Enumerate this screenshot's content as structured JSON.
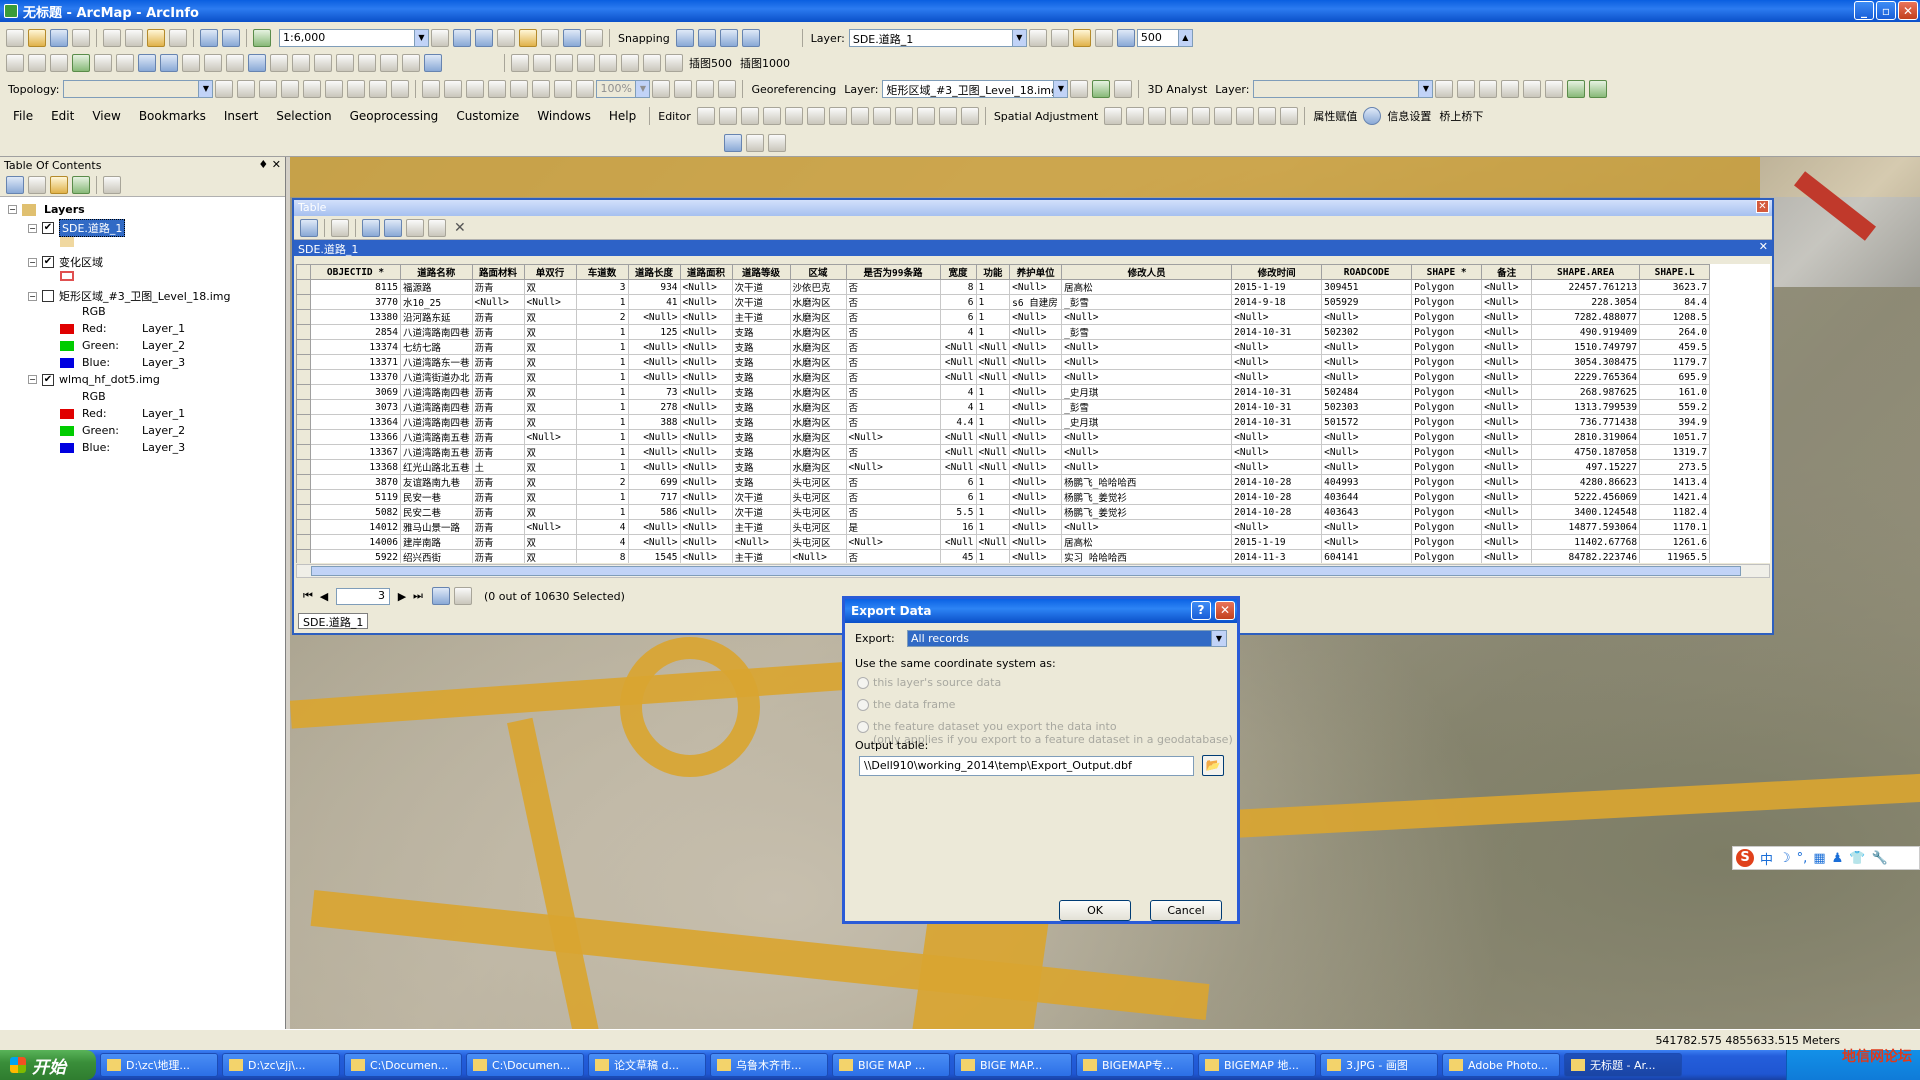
{
  "window": {
    "title": "无标题 - ArcMap - ArcInfo"
  },
  "toolbar": {
    "scale": "1:6,000",
    "snapping": "Snapping",
    "layer_label": "Layer:",
    "layer_value": "SDE.道路_1",
    "number_value": "500",
    "topology_label": "Topology:",
    "georef_label": "Georeferencing",
    "georef_layer_label": "Layer:",
    "georef_layer_value": "矩形区域_#3_卫图_Level_18.img",
    "zoom_percent": "100%",
    "analyst_3d": "3D Analyst",
    "analyst_layer_label": "Layer:",
    "btn_insert500": "插图500",
    "btn_insert1000": "插图1000",
    "editor": "Editor",
    "spatial_adjustment": "Spatial Adjustment",
    "attr_assign": "属性赋值",
    "info_settings": "信息设置",
    "bridge": "桥上桥下"
  },
  "menu": [
    "File",
    "Edit",
    "View",
    "Bookmarks",
    "Insert",
    "Selection",
    "Geoprocessing",
    "Customize",
    "Windows",
    "Help"
  ],
  "toc": {
    "title": "Table Of Contents",
    "root": "Layers",
    "layers": [
      {
        "name": "SDE.道路_1",
        "checked": true,
        "selected": true
      },
      {
        "name": "变化区域",
        "checked": true
      },
      {
        "name": "矩形区域_#3_卫图_Level_18.img",
        "checked": false
      },
      {
        "name": "wlmq_hf_dot5.img",
        "checked": true
      }
    ],
    "rgb": "RGB",
    "bands": [
      {
        "label": "Red:",
        "value": "Layer_1",
        "color": "#e00000"
      },
      {
        "label": "Green:",
        "value": "Layer_2",
        "color": "#00cc00"
      },
      {
        "label": "Blue:",
        "value": "Layer_3",
        "color": "#0000e0"
      }
    ]
  },
  "table": {
    "window_title": "Table",
    "tab_title": "SDE.道路_1",
    "columns": [
      "OBJECTID *",
      "道路名称",
      "路面材料",
      "单双行",
      "车道数",
      "道路长度",
      "道路面积",
      "道路等级",
      "区域",
      "是否为99条路",
      "宽度",
      "功能",
      "养护单位",
      "修改人员",
      "修改时间",
      "ROADCODE",
      "SHAPE *",
      "备注",
      "SHAPE.AREA",
      "SHAPE.L"
    ],
    "rows": [
      [
        "8115",
        "福源路",
        "沥青",
        "双",
        "3",
        "934",
        "<Null>",
        "次干道",
        "沙依巴克",
        "否",
        "8",
        "1",
        "<Null>",
        "居高松",
        "2015-1-19",
        "309451",
        "Polygon",
        "<Null>",
        "22457.761213",
        "3623.7"
      ],
      [
        "3770",
        "水10_25",
        "<Null>",
        "<Null>",
        "1",
        "41",
        "<Null>",
        "次干道",
        "水磨沟区",
        "否",
        "6",
        "1",
        "s6 自建房",
        "_彭雪",
        "2014-9-18",
        "505929",
        "Polygon",
        "<Null>",
        "228.3054",
        "84.4"
      ],
      [
        "13380",
        "沿河路东延",
        "沥青",
        "双",
        "2",
        "<Null>",
        "<Null>",
        "主干道",
        "水磨沟区",
        "否",
        "6",
        "1",
        "<Null>",
        "<Null>",
        "<Null>",
        "<Null>",
        "Polygon",
        "<Null>",
        "7282.488077",
        "1208.5"
      ],
      [
        "2854",
        "八道湾路南四巷",
        "沥青",
        "双",
        "1",
        "125",
        "<Null>",
        "支路",
        "水磨沟区",
        "否",
        "4",
        "1",
        "<Null>",
        "_彭雪",
        "2014-10-31",
        "502302",
        "Polygon",
        "<Null>",
        "490.919409",
        "264.0"
      ],
      [
        "13374",
        "七纺七路",
        "沥青",
        "双",
        "1",
        "<Null>",
        "<Null>",
        "支路",
        "水磨沟区",
        "否",
        "<Null",
        "<Null",
        "<Null>",
        "<Null>",
        "<Null>",
        "<Null>",
        "Polygon",
        "<Null>",
        "1510.749797",
        "459.5"
      ],
      [
        "13371",
        "八道湾路东一巷",
        "沥青",
        "双",
        "1",
        "<Null>",
        "<Null>",
        "支路",
        "水磨沟区",
        "否",
        "<Null",
        "<Null",
        "<Null>",
        "<Null>",
        "<Null>",
        "<Null>",
        "Polygon",
        "<Null>",
        "3054.308475",
        "1179.7"
      ],
      [
        "13370",
        "八道湾街道办北",
        "沥青",
        "双",
        "1",
        "<Null>",
        "<Null>",
        "支路",
        "水磨沟区",
        "否",
        "<Null",
        "<Null",
        "<Null>",
        "<Null>",
        "<Null>",
        "<Null>",
        "Polygon",
        "<Null>",
        "2229.765364",
        "695.9"
      ],
      [
        "3069",
        "八道湾路南四巷",
        "沥青",
        "双",
        "1",
        "73",
        "<Null>",
        "支路",
        "水磨沟区",
        "否",
        "4",
        "1",
        "<Null>",
        "_史月琪",
        "2014-10-31",
        "502484",
        "Polygon",
        "<Null>",
        "268.987625",
        "161.0"
      ],
      [
        "3073",
        "八道湾路南四巷",
        "沥青",
        "双",
        "1",
        "278",
        "<Null>",
        "支路",
        "水磨沟区",
        "否",
        "4",
        "1",
        "<Null>",
        "_彭雪",
        "2014-10-31",
        "502303",
        "Polygon",
        "<Null>",
        "1313.799539",
        "559.2"
      ],
      [
        "13364",
        "八道湾路南四巷",
        "沥青",
        "双",
        "1",
        "388",
        "<Null>",
        "支路",
        "水磨沟区",
        "否",
        "4.4",
        "1",
        "<Null>",
        "_史月琪",
        "2014-10-31",
        "501572",
        "Polygon",
        "<Null>",
        "736.771438",
        "394.9"
      ],
      [
        "13366",
        "八道湾路南五巷",
        "沥青",
        "<Null>",
        "1",
        "<Null>",
        "<Null>",
        "支路",
        "水磨沟区",
        "<Null>",
        "<Null",
        "<Null",
        "<Null>",
        "<Null>",
        "<Null>",
        "<Null>",
        "Polygon",
        "<Null>",
        "2810.319064",
        "1051.7"
      ],
      [
        "13367",
        "八道湾路南五巷",
        "沥青",
        "双",
        "1",
        "<Null>",
        "<Null>",
        "支路",
        "水磨沟区",
        "否",
        "<Null",
        "<Null",
        "<Null>",
        "<Null>",
        "<Null>",
        "<Null>",
        "Polygon",
        "<Null>",
        "4750.187058",
        "1319.7"
      ],
      [
        "13368",
        "红光山路北五巷",
        "土",
        "双",
        "1",
        "<Null>",
        "<Null>",
        "支路",
        "水磨沟区",
        "<Null>",
        "<Null",
        "<Null",
        "<Null>",
        "<Null>",
        "<Null>",
        "<Null>",
        "Polygon",
        "<Null>",
        "497.15227",
        "273.5"
      ],
      [
        "3870",
        "友谊路南九巷",
        "沥青",
        "双",
        "2",
        "699",
        "<Null>",
        "支路",
        "头屯河区",
        "否",
        "6",
        "1",
        "<Null>",
        "杨鹏飞_哈哈哈西",
        "2014-10-28",
        "404993",
        "Polygon",
        "<Null>",
        "4280.86623",
        "1413.4"
      ],
      [
        "5119",
        "民安一巷",
        "沥青",
        "双",
        "1",
        "717",
        "<Null>",
        "次干道",
        "头屯河区",
        "否",
        "6",
        "1",
        "<Null>",
        "杨鹏飞_姜觉衫",
        "2014-10-28",
        "403644",
        "Polygon",
        "<Null>",
        "5222.456069",
        "1421.4"
      ],
      [
        "5082",
        "民安二巷",
        "沥青",
        "双",
        "1",
        "586",
        "<Null>",
        "次干道",
        "头屯河区",
        "否",
        "5.5",
        "1",
        "<Null>",
        "杨鹏飞_姜觉衫",
        "2014-10-28",
        "403643",
        "Polygon",
        "<Null>",
        "3400.124548",
        "1182.4"
      ],
      [
        "14012",
        "雅马山景一路",
        "沥青",
        "<Null>",
        "4",
        "<Null>",
        "<Null>",
        "主干道",
        "头屯河区",
        "是",
        "16",
        "1",
        "<Null>",
        "<Null>",
        "<Null>",
        "<Null>",
        "Polygon",
        "<Null>",
        "14877.593064",
        "1170.1"
      ],
      [
        "14006",
        "建岸南路",
        "沥青",
        "双",
        "4",
        "<Null>",
        "<Null>",
        "<Null>",
        "头屯河区",
        "<Null>",
        "<Null",
        "<Null",
        "<Null>",
        "居高松",
        "2015-1-19",
        "<Null>",
        "Polygon",
        "<Null>",
        "11402.67768",
        "1261.6"
      ],
      [
        "5922",
        "绍兴西街",
        "沥青",
        "双",
        "8",
        "1545",
        "<Null>",
        "主干道",
        "<Null>",
        "否",
        "45",
        "1",
        "<Null>",
        "实习_哈哈哈西",
        "2014-11-3",
        "604141",
        "Polygon",
        "<Null>",
        "84782.223746",
        "11965.5"
      ]
    ],
    "page": "3",
    "selection_info": "(0 out of 10630 Selected)",
    "bottom_tab": "SDE.道路_1"
  },
  "dialog": {
    "title": "Export Data",
    "export_label": "Export:",
    "export_value": "All records",
    "coord_label": "Use the same coordinate system as:",
    "opt1": "this layer's source data",
    "opt2": "the data frame",
    "opt3": "the feature dataset you export the data into",
    "opt3_note": "(only applies if you export to a feature dataset in a geodatabase)",
    "output_label": "Output table:",
    "output_value": "\\\\Dell910\\working_2014\\temp\\Export_Output.dbf",
    "ok": "OK",
    "cancel": "Cancel",
    "help_glyph": "?",
    "close_glyph": "✕"
  },
  "ime": [
    "中",
    "☽",
    "°,",
    "▦",
    "♟",
    "👕",
    "🔧"
  ],
  "status": {
    "coords": "541782.575   4855633.515 Meters"
  },
  "taskbar": {
    "start": "开始",
    "tasks": [
      "D:\\zc\\地理...",
      "D:\\zc\\zjj\\...",
      "C:\\Documen...",
      "C:\\Documen...",
      "论文草稿 d...",
      "乌鲁木齐市...",
      "BIGE MAP ...",
      "BIGE MAP...",
      "BIGEMAP专...",
      "BIGEMAP 地...",
      "3.JPG - 画图",
      "Adobe Photo...",
      "无标题 - Ar..."
    ],
    "watermark": "地信网论坛"
  }
}
